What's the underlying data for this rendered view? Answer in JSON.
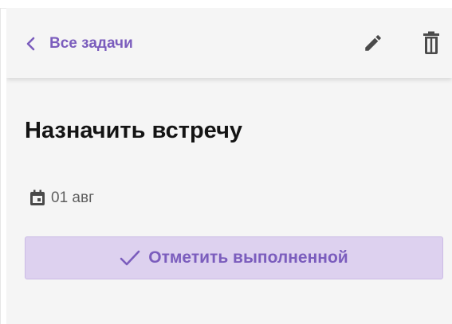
{
  "header": {
    "back_label": "Все задачи",
    "back_icon": "chevron-left-icon",
    "edit_icon": "pencil-icon",
    "delete_icon": "trash-icon"
  },
  "task": {
    "title": "Назначить встречу",
    "date": "01 авг",
    "date_icon": "calendar-icon"
  },
  "actions": {
    "complete_label": "Отметить выполненной",
    "complete_icon": "checkmark-icon"
  },
  "colors": {
    "accent": "#7b5dbd",
    "button_background": "#ddd1ef",
    "panel_background": "#f5f5f5",
    "title_text": "#141414",
    "icon_dark": "#4a4a4a"
  }
}
